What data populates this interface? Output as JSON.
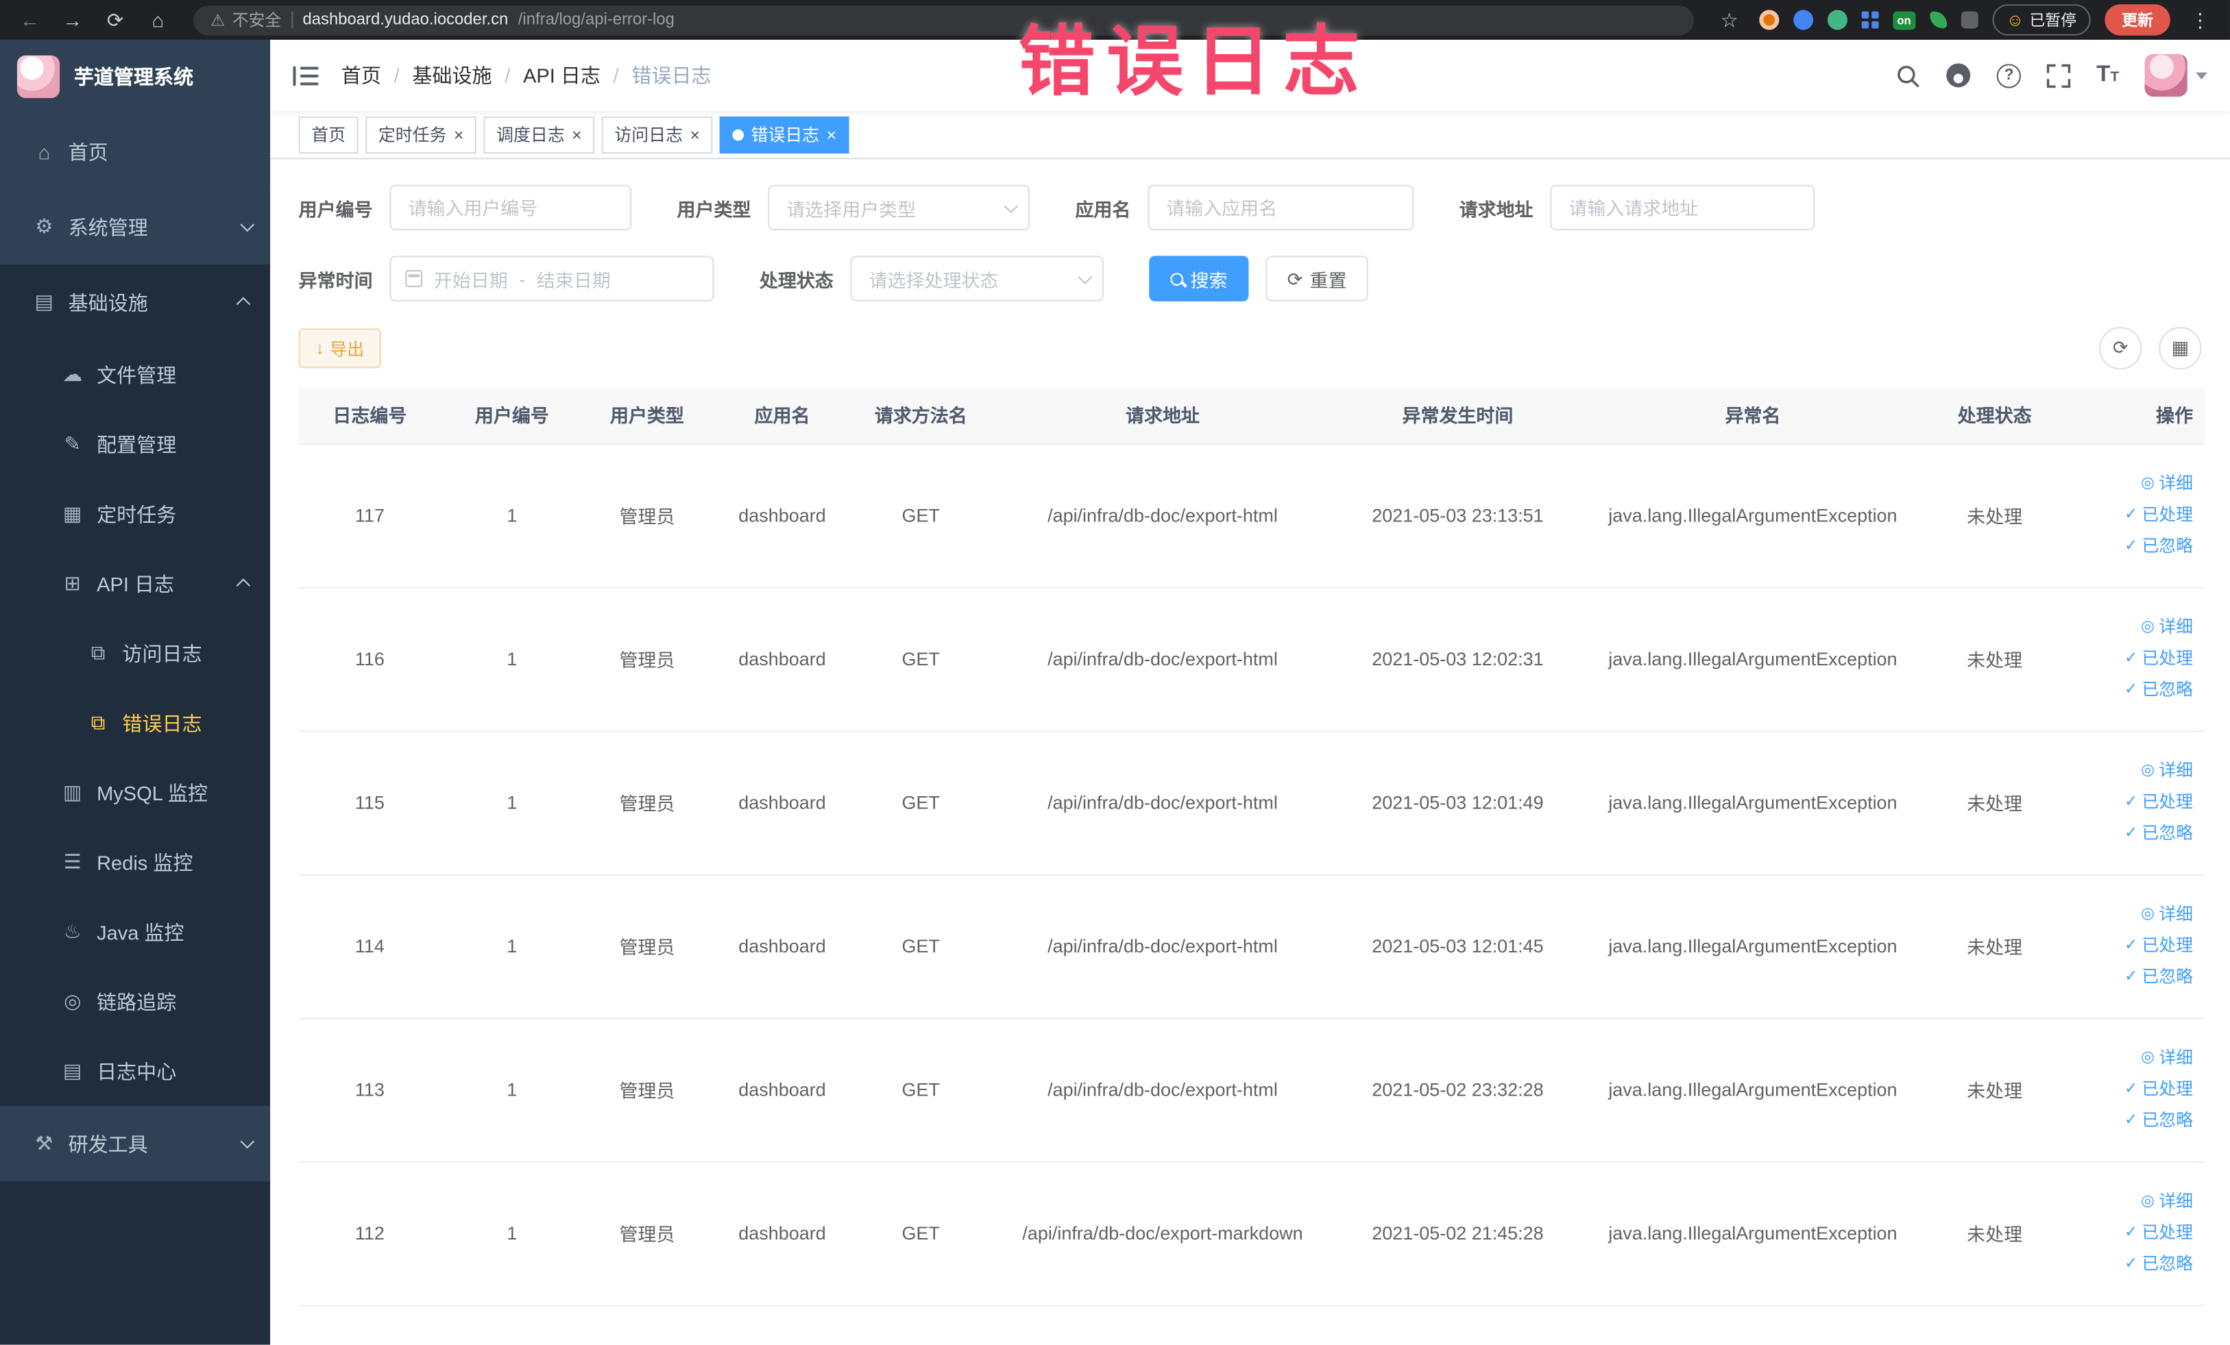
{
  "browser": {
    "security_label": "不安全",
    "url_domain": "dashboard.yudao.iocoder.cn",
    "url_path": "/infra/log/api-error-log",
    "ext_on_badge": "on",
    "paused_badge": "已暂停",
    "update_button": "更新"
  },
  "overlay_title": "错误日志",
  "icons": {
    "back": "←",
    "forward": "→",
    "reload": "⟳",
    "home": "⌂",
    "warning": "⚠",
    "bookmark": "☆",
    "kebab": "⋮",
    "emoji_face": "☺",
    "close": "×",
    "question": "?",
    "font": "T",
    "refresh": "⟳",
    "columns": "▦",
    "download": "↓",
    "detail": "◎",
    "check": "✓"
  },
  "sidebar": {
    "logo_title": "芋道管理系统",
    "items": [
      {
        "label": "首页",
        "icon": "⌂"
      },
      {
        "label": "系统管理",
        "icon": "⚙"
      },
      {
        "label": "基础设施",
        "icon": "▤"
      },
      {
        "label": "文件管理",
        "icon": "☁"
      },
      {
        "label": "配置管理",
        "icon": "✎"
      },
      {
        "label": "定时任务",
        "icon": "▦"
      },
      {
        "label": "API 日志",
        "icon": "⊞"
      },
      {
        "label": "访问日志",
        "icon": "⧉"
      },
      {
        "label": "错误日志",
        "icon": "⧉"
      },
      {
        "label": "MySQL 监控",
        "icon": "▥"
      },
      {
        "label": "Redis 监控",
        "icon": "☰"
      },
      {
        "label": "Java 监控",
        "icon": "♨"
      },
      {
        "label": "链路追踪",
        "icon": "◎"
      },
      {
        "label": "日志中心",
        "icon": "▤"
      },
      {
        "label": "研发工具",
        "icon": "⚒"
      }
    ]
  },
  "breadcrumb": {
    "separator": "/",
    "items": [
      "首页",
      "基础设施",
      "API 日志",
      "错误日志"
    ]
  },
  "tags": [
    {
      "label": "首页"
    },
    {
      "label": "定时任务"
    },
    {
      "label": "调度日志"
    },
    {
      "label": "访问日志"
    },
    {
      "label": "错误日志"
    }
  ],
  "filters": {
    "user_id": {
      "label": "用户编号",
      "placeholder": "请输入用户编号"
    },
    "user_type": {
      "label": "用户类型",
      "placeholder": "请选择用户类型"
    },
    "app_name": {
      "label": "应用名",
      "placeholder": "请输入应用名"
    },
    "request_url": {
      "label": "请求地址",
      "placeholder": "请输入请求地址"
    },
    "exception_time": {
      "label": "异常时间",
      "start_placeholder": "开始日期",
      "separator": "-",
      "end_placeholder": "结束日期"
    },
    "process_status": {
      "label": "处理状态",
      "placeholder": "请选择处理状态"
    },
    "search_button": "搜索",
    "reset_button": "重置"
  },
  "toolbar": {
    "export_button": "导出"
  },
  "table": {
    "columns": [
      "日志编号",
      "用户编号",
      "用户类型",
      "应用名",
      "请求方法名",
      "请求地址",
      "异常发生时间",
      "异常名",
      "处理状态",
      "操作"
    ],
    "actions": {
      "detail": "详细",
      "processed": "已处理",
      "ignored": "已忽略"
    },
    "rows": [
      {
        "id": "117",
        "user_id": "1",
        "user_type": "管理员",
        "app_name": "dashboard",
        "method": "GET",
        "url": "/api/infra/db-doc/export-html",
        "time": "2021-05-03 23:13:51",
        "exception": "java.lang.IllegalArgumentException",
        "status": "未处理"
      },
      {
        "id": "116",
        "user_id": "1",
        "user_type": "管理员",
        "app_name": "dashboard",
        "method": "GET",
        "url": "/api/infra/db-doc/export-html",
        "time": "2021-05-03 12:02:31",
        "exception": "java.lang.IllegalArgumentException",
        "status": "未处理"
      },
      {
        "id": "115",
        "user_id": "1",
        "user_type": "管理员",
        "app_name": "dashboard",
        "method": "GET",
        "url": "/api/infra/db-doc/export-html",
        "time": "2021-05-03 12:01:49",
        "exception": "java.lang.IllegalArgumentException",
        "status": "未处理"
      },
      {
        "id": "114",
        "user_id": "1",
        "user_type": "管理员",
        "app_name": "dashboard",
        "method": "GET",
        "url": "/api/infra/db-doc/export-html",
        "time": "2021-05-03 12:01:45",
        "exception": "java.lang.IllegalArgumentException",
        "status": "未处理"
      },
      {
        "id": "113",
        "user_id": "1",
        "user_type": "管理员",
        "app_name": "dashboard",
        "method": "GET",
        "url": "/api/infra/db-doc/export-html",
        "time": "2021-05-02 23:32:28",
        "exception": "java.lang.IllegalArgumentException",
        "status": "未处理"
      },
      {
        "id": "112",
        "user_id": "1",
        "user_type": "管理员",
        "app_name": "dashboard",
        "method": "GET",
        "url": "/api/infra/db-doc/export-markdown",
        "time": "2021-05-02 21:45:28",
        "exception": "java.lang.IllegalArgumentException",
        "status": "未处理"
      }
    ]
  },
  "colors": {
    "primary": "#409eff",
    "sidebar_bg": "#1f2d3d",
    "sidebar_highlight": "#304156",
    "active_menu_text": "#ffd04b",
    "warning": "#e6a23c",
    "overlay_red": "#f5476b"
  }
}
